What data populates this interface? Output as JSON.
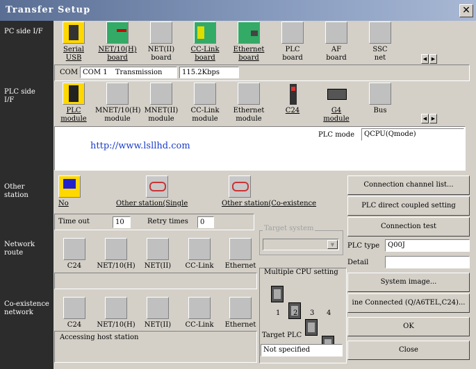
{
  "window": {
    "title": "Transfer Setup",
    "close_glyph": "✕"
  },
  "sidebar": {
    "pc_side": "PC side I/F",
    "plc_side": "PLC side I/F",
    "other_station": "Other station",
    "network_route": "Network route",
    "coexistence": "Co-existence network"
  },
  "pc_side": {
    "items": [
      {
        "line1": "Serial",
        "line2": "USB",
        "icon": "serial-usb-icon"
      },
      {
        "line1": "NET/10(H)",
        "line2": "board",
        "icon": "net10h-board-icon"
      },
      {
        "line1": "NET(II)",
        "line2": "board",
        "icon": "net-ii-board-icon"
      },
      {
        "line1": "CC-Link",
        "line2": "board",
        "icon": "cc-link-board-icon"
      },
      {
        "line1": "Ethernet",
        "line2": "board",
        "icon": "ethernet-board-icon"
      },
      {
        "line1": "PLC",
        "line2": "board",
        "icon": "plc-board-icon"
      },
      {
        "line1": "AF",
        "line2": "board",
        "icon": "af-board-icon"
      },
      {
        "line1": "SSC",
        "line2": "net",
        "icon": "ssc-net-icon"
      }
    ],
    "com_label": "COM",
    "com_value": "COM 1",
    "transmission_label": "Transmission",
    "transmission_value": "115.2Kbps"
  },
  "plc_side": {
    "items": [
      {
        "line1": "PLC",
        "line2": "module",
        "icon": "plc-module-icon"
      },
      {
        "line1": "MNET/10(H)",
        "line2": "module",
        "icon": "mnet10h-module-icon"
      },
      {
        "line1": "MNET(II)",
        "line2": "module",
        "icon": "mnet-ii-module-icon"
      },
      {
        "line1": "CC-Link",
        "line2": "module",
        "icon": "cc-link-module-icon"
      },
      {
        "line1": "Ethernet",
        "line2": "module",
        "icon": "ethernet-module-icon"
      },
      {
        "line1": "C24",
        "line2": "",
        "icon": "c24-icon"
      },
      {
        "line1": "G4",
        "line2": "module",
        "icon": "g4-module-icon"
      },
      {
        "line1": "Bus",
        "line2": "",
        "icon": "bus-icon"
      }
    ],
    "plc_mode_label": "PLC mode",
    "plc_mode_value": "QCPU(Qmode)",
    "url": "http://www.lsllhd.com"
  },
  "other_station": {
    "items": [
      {
        "label": "No",
        "icon": "no-station-icon"
      },
      {
        "label": "Other station(Single",
        "icon": "other-station-single-icon"
      },
      {
        "label": "Other station(Co-existence",
        "icon": "other-station-coexist-icon"
      }
    ],
    "timeout_label": "Time out",
    "timeout_value": "10",
    "retry_label": "Retry times",
    "retry_value": "0"
  },
  "network_route": {
    "items": [
      "C24",
      "NET/10(H)",
      "NET(II)",
      "CC-Link",
      "Ethernet"
    ]
  },
  "coexistence": {
    "items": [
      "C24",
      "NET/10(H)",
      "NET(II)",
      "CC-Link",
      "Ethernet"
    ],
    "status_text": "Accessing host station"
  },
  "target_system": {
    "label": "Target system",
    "value": ""
  },
  "multiple_cpu": {
    "label": "Multiple CPU setting",
    "cpus": [
      "1",
      "2",
      "3",
      "4"
    ],
    "target_plc_label": "Target PLC",
    "target_plc_value": "Not specified"
  },
  "right_panel": {
    "connection_channel": "Connection  channel  list...",
    "plc_direct": "PLC direct coupled setting",
    "connection_test": "Connection test",
    "plc_type_label": "PLC type",
    "plc_type_value": "Q00J",
    "detail_label": "Detail",
    "detail_value": "",
    "system_image": "System   image...",
    "line_connected": "ine Connected (Q/A6TEL,C24)...",
    "ok": "OK",
    "close": "Close"
  }
}
